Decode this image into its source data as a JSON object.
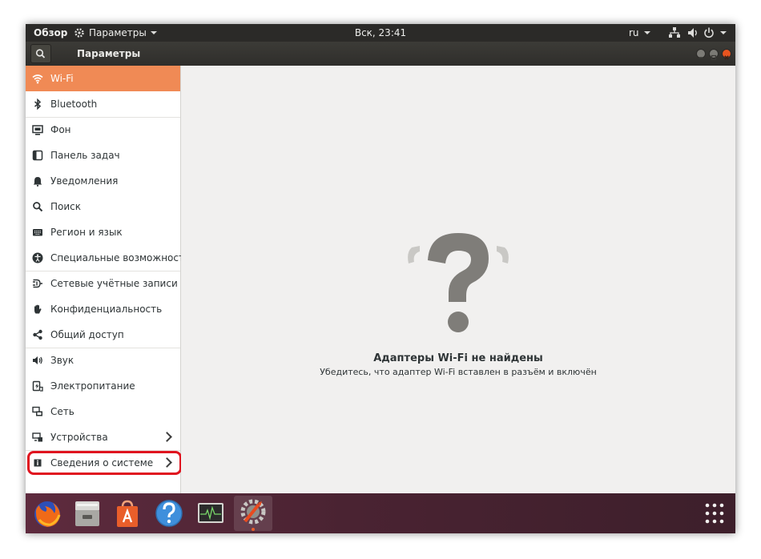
{
  "topbar": {
    "activities": "Обзор",
    "app_menu": "Параметры",
    "clock": "Вск, 23:41",
    "language": "ru"
  },
  "header": {
    "title": "Параметры"
  },
  "sidebar": {
    "items": [
      {
        "label": "Wi-Fi",
        "icon": "wifi-icon",
        "selected": true
      },
      {
        "label": "Bluetooth",
        "icon": "bluetooth-icon"
      },
      {
        "label": "Фон",
        "icon": "background-icon"
      },
      {
        "label": "Панель задач",
        "icon": "dock-icon"
      },
      {
        "label": "Уведомления",
        "icon": "bell-icon"
      },
      {
        "label": "Поиск",
        "icon": "search-icon"
      },
      {
        "label": "Регион и язык",
        "icon": "keyboard-icon"
      },
      {
        "label": "Специальные возможности",
        "icon": "accessibility-icon"
      },
      {
        "label": "Сетевые учётные записи",
        "icon": "online-accounts-icon"
      },
      {
        "label": "Конфиденциальность",
        "icon": "hand-icon"
      },
      {
        "label": "Общий доступ",
        "icon": "share-icon"
      },
      {
        "label": "Звук",
        "icon": "speaker-icon"
      },
      {
        "label": "Электропитание",
        "icon": "power-icon"
      },
      {
        "label": "Сеть",
        "icon": "network-icon"
      },
      {
        "label": "Устройства",
        "icon": "devices-icon",
        "has_chevron": true
      },
      {
        "label": "Сведения о системе",
        "icon": "info-icon",
        "has_chevron": true,
        "highlighted": true
      }
    ]
  },
  "main": {
    "empty_title": "Адаптеры Wi-Fi не найдены",
    "empty_subtitle": "Убедитесь, что адаптер Wi-Fi вставлен в разъём и включён"
  },
  "dock": {
    "apps": [
      "firefox-icon",
      "files-icon",
      "software-center-icon",
      "help-icon",
      "system-monitor-icon",
      "settings-icon"
    ]
  },
  "colors": {
    "accent": "#f08a55",
    "highlight_frame": "#e0141f",
    "topbar": "#2b2a28",
    "dock": "#4a2332"
  }
}
